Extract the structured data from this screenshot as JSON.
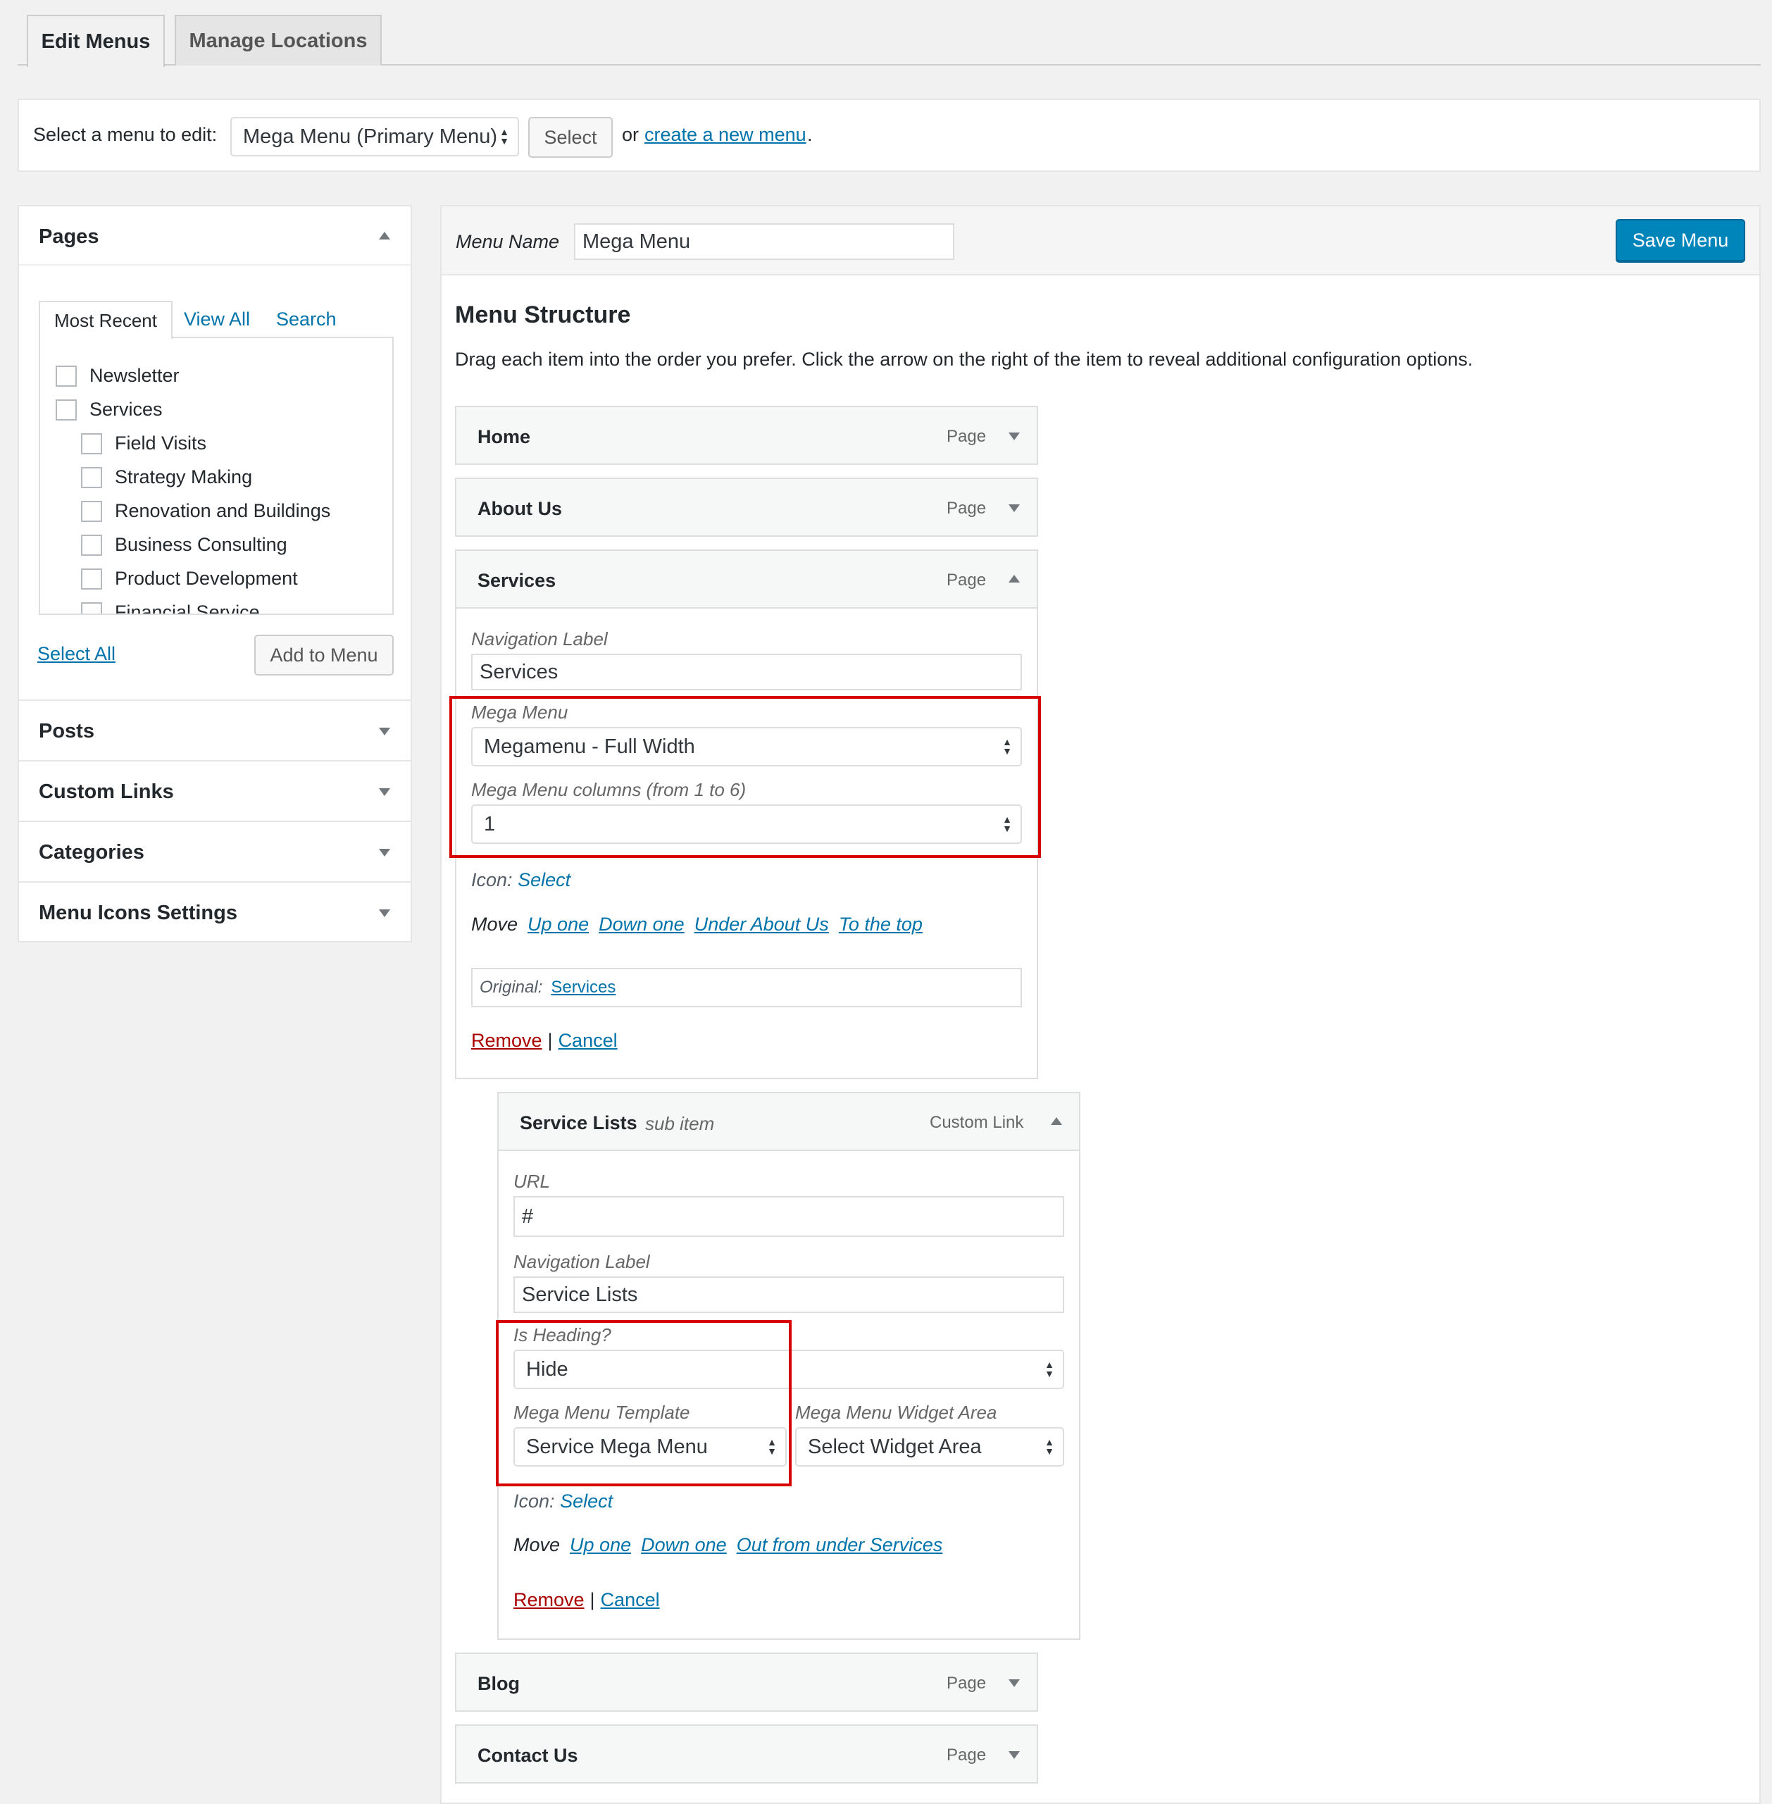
{
  "tabs": {
    "edit_menus": "Edit Menus",
    "manage_locations": "Manage Locations"
  },
  "select_bar": {
    "prompt": "Select a menu to edit:",
    "selected_menu": "Mega Menu (Primary Menu)",
    "select_button": "Select",
    "or_text": "or",
    "create_link": "create a new menu",
    "period": "."
  },
  "pages_box": {
    "title": "Pages",
    "tabs": {
      "most_recent": "Most Recent",
      "view_all": "View All",
      "search": "Search"
    },
    "items": [
      "Newsletter",
      "Services",
      "Field Visits",
      "Strategy Making",
      "Renovation and Buildings",
      "Business Consulting",
      "Product Development",
      "Financial Service"
    ],
    "select_all": "Select All",
    "add_button": "Add to Menu"
  },
  "accordion": [
    "Posts",
    "Custom Links",
    "Categories",
    "Menu Icons Settings"
  ],
  "menu_header": {
    "name_label": "Menu Name",
    "name_value": "Mega Menu",
    "save_button": "Save Menu"
  },
  "structure": {
    "title": "Menu Structure",
    "description": "Drag each item into the order you prefer. Click the arrow on the right of the item to reveal additional configuration options."
  },
  "items": {
    "home": {
      "title": "Home",
      "type": "Page"
    },
    "about": {
      "title": "About Us",
      "type": "Page"
    },
    "services": {
      "title": "Services",
      "type": "Page"
    },
    "blog": {
      "title": "Blog",
      "type": "Page"
    },
    "contact": {
      "title": "Contact Us",
      "type": "Page"
    }
  },
  "services_settings": {
    "nav_label": "Navigation Label",
    "nav_value": "Services",
    "mega_label": "Mega Menu",
    "mega_value": "Megamenu - Full Width",
    "columns_label": "Mega Menu columns (from 1 to 6)",
    "columns_value": "1",
    "icon_label": "Icon:",
    "icon_link": "Select",
    "move_label": "Move",
    "move_links": [
      "Up one",
      "Down one",
      "Under About Us",
      "To the top"
    ],
    "original_label": "Original:",
    "original_link": "Services",
    "remove": "Remove",
    "separator": "|",
    "cancel": "Cancel"
  },
  "sub_item": {
    "title": "Service Lists",
    "subtitle": "sub item",
    "type": "Custom Link",
    "url_label": "URL",
    "url_value": "#",
    "nav_label": "Navigation Label",
    "nav_value": "Service Lists",
    "heading_label": "Is Heading?",
    "heading_value": "Hide",
    "template_label": "Mega Menu Template",
    "template_value": "Service Mega Menu",
    "widget_label": "Mega Menu Widget Area",
    "widget_value": "Select Widget Area",
    "icon_label": "Icon:",
    "icon_link": "Select",
    "move_label": "Move",
    "move_links": [
      "Up one",
      "Down one",
      "Out from under Services"
    ],
    "remove": "Remove",
    "separator": "|",
    "cancel": "Cancel"
  },
  "colors": {
    "accent": "#0085ba",
    "link": "#0073aa",
    "highlight_box": "#d60000",
    "remove_link": "#aa0000"
  }
}
